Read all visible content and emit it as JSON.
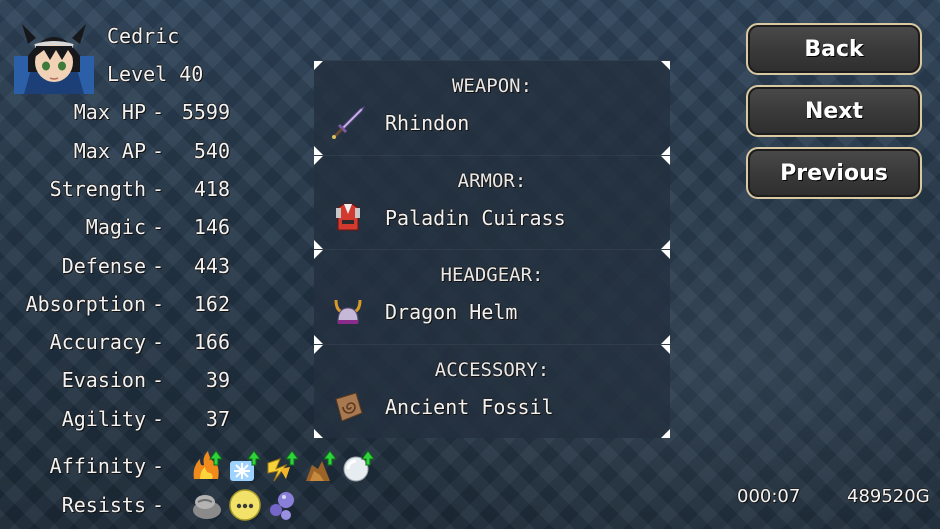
{
  "character": {
    "name": "Cedric",
    "level_label": "Level 40"
  },
  "stats": [
    {
      "label": "Max HP",
      "value": "5599"
    },
    {
      "label": "Max AP",
      "value": "540"
    },
    {
      "label": "Strength",
      "value": "418"
    },
    {
      "label": "Magic",
      "value": "146"
    },
    {
      "label": "Defense",
      "value": "443"
    },
    {
      "label": "Absorption",
      "value": "162"
    },
    {
      "label": "Accuracy",
      "value": "166"
    },
    {
      "label": "Evasion",
      "value": "39"
    },
    {
      "label": "Agility",
      "value": "37"
    }
  ],
  "separator": "-",
  "affinity": {
    "label": "Affinity",
    "icons": [
      "fire-up-icon",
      "ice-up-icon",
      "lightning-up-icon",
      "earth-up-icon",
      "light-up-icon"
    ]
  },
  "resists": {
    "label": "Resists",
    "icons": [
      "stone-status-icon",
      "silence-status-icon",
      "poison-bubbles-icon"
    ]
  },
  "equipment": [
    {
      "slot": "WEAPON:",
      "item": "Rhindon",
      "icon": "sword-icon"
    },
    {
      "slot": "ARMOR:",
      "item": "Paladin Cuirass",
      "icon": "armor-icon"
    },
    {
      "slot": "HEADGEAR:",
      "item": "Dragon Helm",
      "icon": "helm-icon"
    },
    {
      "slot": "ACCESSORY:",
      "item": "Ancient Fossil",
      "icon": "fossil-icon"
    }
  ],
  "buttons": {
    "back": "Back",
    "next": "Next",
    "previous": "Previous"
  },
  "footer": {
    "play_time": "000:07",
    "gold": "489520G"
  }
}
